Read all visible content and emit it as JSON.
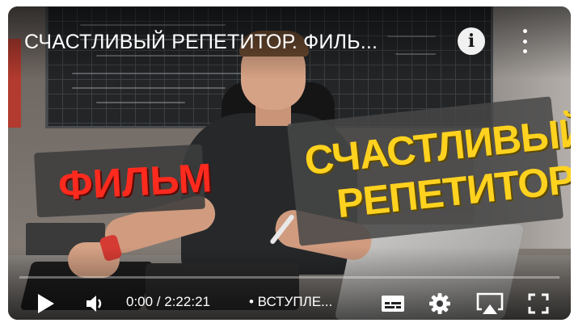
{
  "player": {
    "title": "СЧАСТЛИВЫЙ РЕПЕТИТОР. ФИЛЬ...",
    "thumbnail_text": {
      "film": "ФИЛЬМ",
      "happy_line1": "СЧАСТЛИВЫЙ",
      "happy_line2": "РЕПЕТИТОР"
    },
    "time_display": "0:00 / 2:22:21",
    "chapter": "• ВСТУПЛЕ...",
    "progress_fraction": 0.0,
    "icons": {
      "info": "info-icon",
      "more": "more-vert-icon",
      "play": "play-icon",
      "volume": "volume-icon",
      "captions": "subtitles-icon",
      "settings": "gear-icon",
      "cast": "airplay-icon",
      "fullscreen": "fullscreen-icon"
    },
    "colors": {
      "progress": "#ff0000",
      "caption_film": "#ff2a1e",
      "caption_happy": "#ffd21f"
    }
  }
}
